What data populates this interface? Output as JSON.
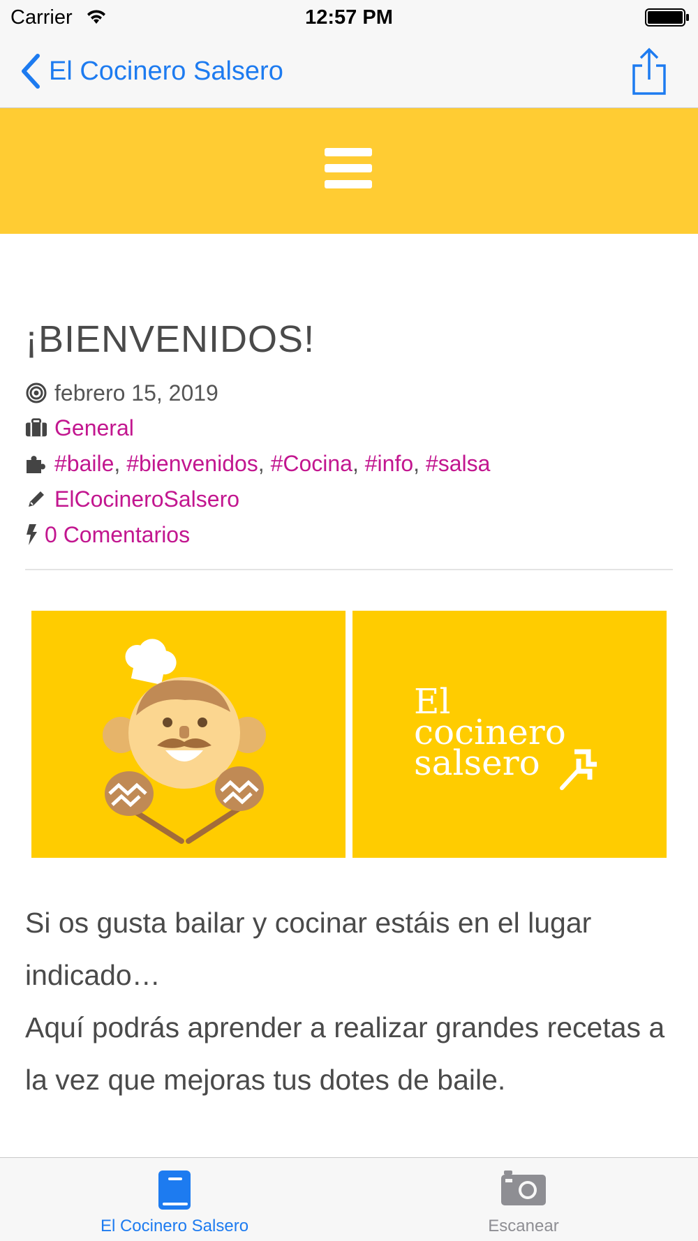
{
  "status_bar": {
    "carrier": "Carrier",
    "time": "12:57 PM"
  },
  "nav": {
    "back_label": "El Cocinero Salsero",
    "accent_color": "#1d7bf0"
  },
  "header": {
    "background_color": "#ffcc33"
  },
  "post": {
    "title": "¡BIENVENIDOS!",
    "date": "febrero 15, 2019",
    "category": "General",
    "tags": [
      "#baile",
      "#bienvenidos",
      "#Cocina",
      "#info",
      "#salsa"
    ],
    "author": "ElCocineroSalsero",
    "comments": "0 Comentarios",
    "link_color": "#c2168f",
    "banner": {
      "logo_line1": "El",
      "logo_line2": "cocinero",
      "logo_line3": "salsero"
    },
    "paragraph1": "Si os gusta bailar y cocinar estáis en el lugar indicado…",
    "paragraph2": "Aquí podrás aprender a realizar grandes recetas a la vez que mejoras tus dotes de baile."
  },
  "tabs": [
    {
      "label": "El Cocinero Salsero",
      "icon": "book-icon",
      "active": true
    },
    {
      "label": "Escanear",
      "icon": "camera-icon",
      "active": false
    }
  ]
}
